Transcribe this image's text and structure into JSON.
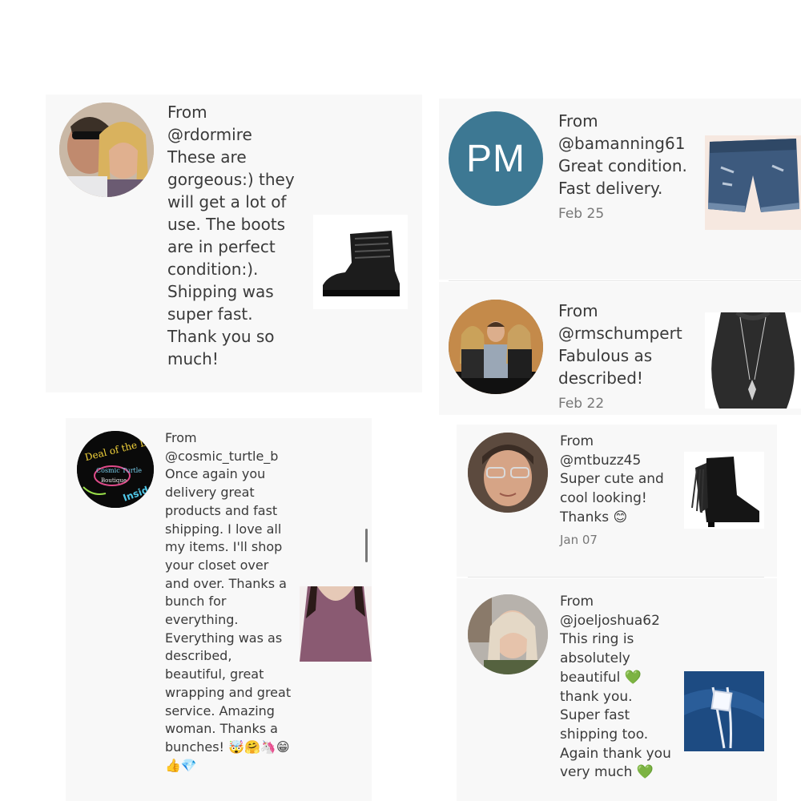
{
  "reviews": [
    {
      "from_label": "From",
      "handle": "@rdormire",
      "message": "These are gorgeous:) they will get a lot of use. The boots are in perfect condition:). Shipping was super fast. Thank you so much!",
      "date": "",
      "product": "boot",
      "avatar": "photo"
    },
    {
      "from_label": "From",
      "handle": "@bamanning61",
      "message": "Great condition. Fast delivery.",
      "date": "Feb 25",
      "product": "denim-shorts",
      "avatar": "initials",
      "avatar_initials": "PM",
      "avatar_color": "#3d7893"
    },
    {
      "from_label": "From",
      "handle": "@rmschumpert",
      "message": "Fabulous as described!",
      "date": "Feb 22",
      "product": "pendant-necklace",
      "avatar": "photo"
    },
    {
      "from_label": "From",
      "handle": "@cosmic_turtle_b",
      "message": "Once again you delivery great products and fast shipping. I love all my items. I'll shop your closet over and over. Thanks a bunch for everything. Everything was as described, beautiful, great wrapping and great service. Amazing woman. Thanks a bunches! 🤯🤗🦄😁👍💎",
      "date": "",
      "product": "mauve-top",
      "avatar": "logo",
      "avatar_logo_text": [
        "Deal of the Day",
        "Cosmic Turtle",
        "Boutique",
        "Inside"
      ]
    },
    {
      "from_label": "From",
      "handle": "@mtbuzz45",
      "message": "Super cute and cool looking! Thanks 😊",
      "date": "Jan 07",
      "product": "fringe-bootie",
      "avatar": "photo"
    },
    {
      "from_label": "From",
      "handle": "@joeljoshua62",
      "message": "This ring is absolutely beautiful 💚 thank you. Super fast shipping too. Again thank you very much 💚",
      "date": "",
      "product": "diamond-ring",
      "avatar": "photo"
    }
  ]
}
